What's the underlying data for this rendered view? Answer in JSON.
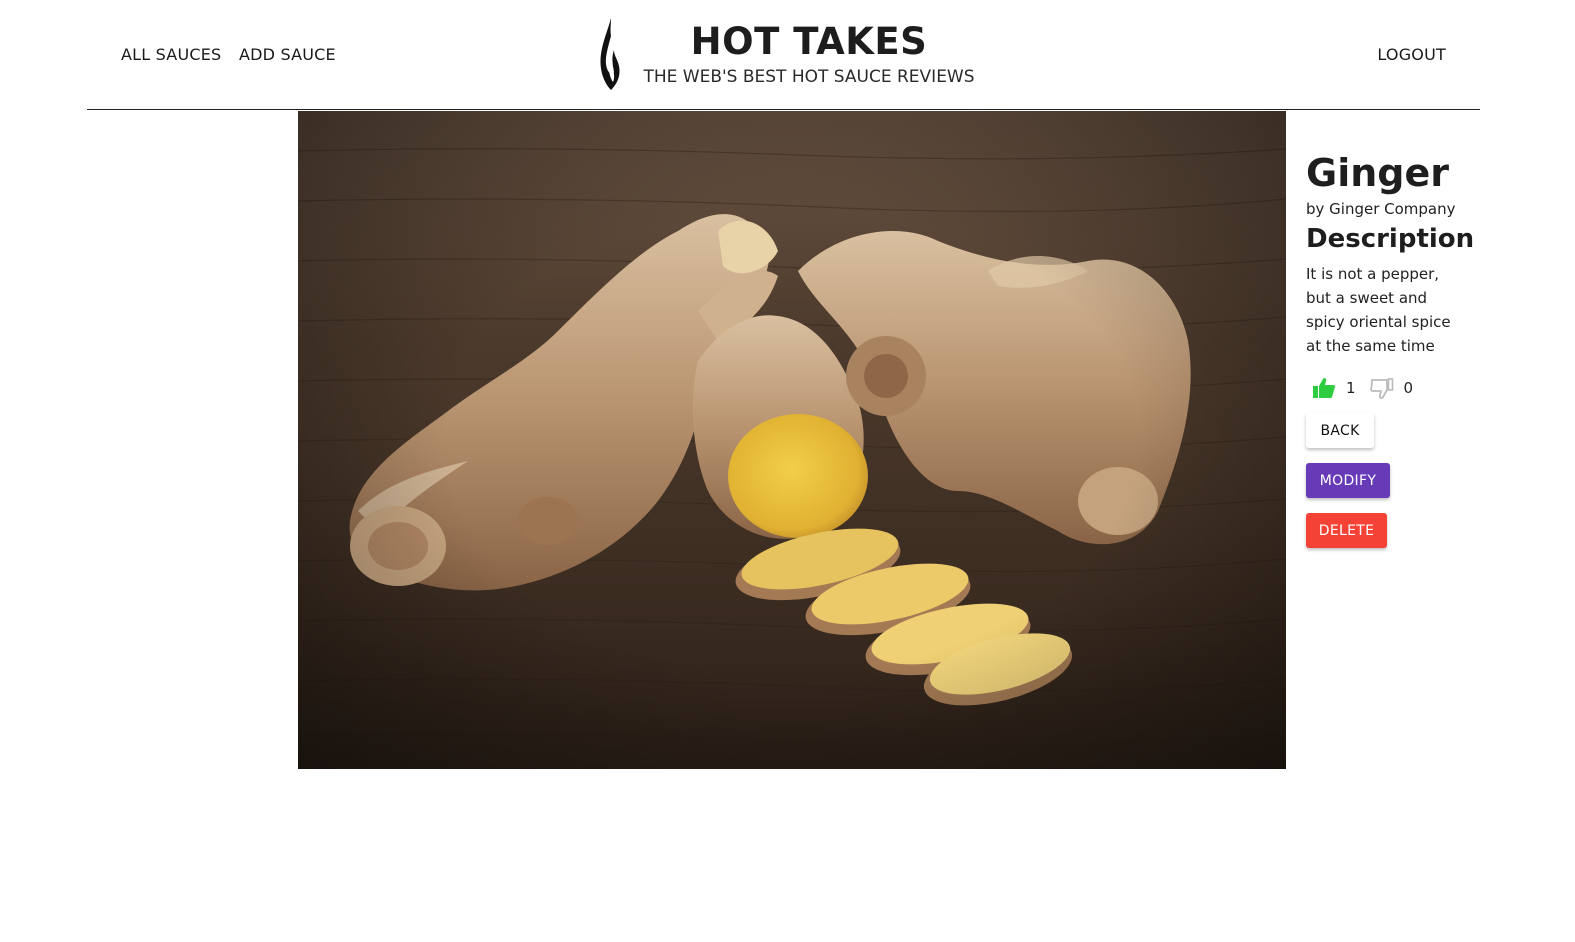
{
  "header": {
    "nav": {
      "all_sauces": "ALL SAUCES",
      "add_sauce": "ADD SAUCE",
      "logout": "LOGOUT"
    },
    "title": "HOT TAKES",
    "subtitle": "THE WEB'S BEST HOT SAUCE REVIEWS",
    "logo_icon": "flame-icon"
  },
  "sauce": {
    "image_subject": "ginger root",
    "name": "Ginger",
    "manufacturer": "by Ginger Company",
    "description_heading": "Description",
    "description": "It is not a pepper, but a sweet and spicy oriental spice at the same time",
    "likes": "1",
    "dislikes": "0",
    "like_icon": "thumbs-up-icon",
    "dislike_icon": "thumbs-down-icon"
  },
  "actions": {
    "back": "BACK",
    "modify": "MODIFY",
    "delete": "DELETE"
  },
  "colors": {
    "like": "#2ecc40",
    "dislike": "#cccccc",
    "modify": "#673ab7",
    "delete": "#f44336"
  }
}
